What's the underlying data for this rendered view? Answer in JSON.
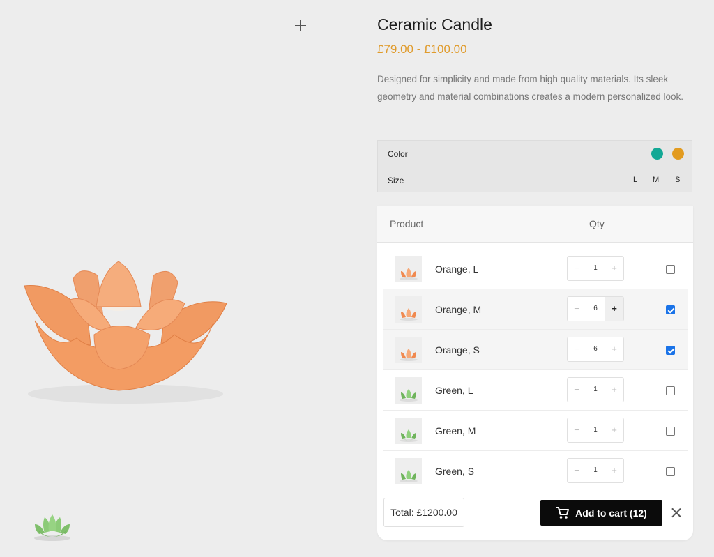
{
  "product": {
    "title": "Ceramic Candle",
    "price_range": "£79.00 - £100.00",
    "description": "Designed for simplicity and made from high quality materials. Its sleek geometry and material combinations creates a modern personalized look."
  },
  "options": {
    "color_label": "Color",
    "colors": [
      {
        "name": "green",
        "hex": "#13a895"
      },
      {
        "name": "orange",
        "hex": "#e29b1f"
      }
    ],
    "size_label": "Size",
    "sizes": [
      "L",
      "M",
      "S"
    ]
  },
  "table": {
    "product_header": "Product",
    "qty_header": "Qty",
    "rows": [
      {
        "label": "Orange, L",
        "qty": "1",
        "checked": false,
        "variant": "orange"
      },
      {
        "label": "Orange, M",
        "qty": "6",
        "checked": true,
        "variant": "orange"
      },
      {
        "label": "Orange, S",
        "qty": "6",
        "checked": true,
        "variant": "orange"
      },
      {
        "label": "Green, L",
        "qty": "1",
        "checked": false,
        "variant": "green"
      },
      {
        "label": "Green, M",
        "qty": "1",
        "checked": false,
        "variant": "green"
      },
      {
        "label": "Green, S",
        "qty": "1",
        "checked": false,
        "variant": "green"
      }
    ],
    "minus_glyph": "−",
    "plus_glyph": "+"
  },
  "footer": {
    "total": "Total: £1200.00",
    "add_to_cart": "Add to cart (12)"
  },
  "colors": {
    "accent_price": "#e09b2b",
    "button_bg": "#0b0b0b",
    "checkbox_on": "#1a73e8"
  }
}
